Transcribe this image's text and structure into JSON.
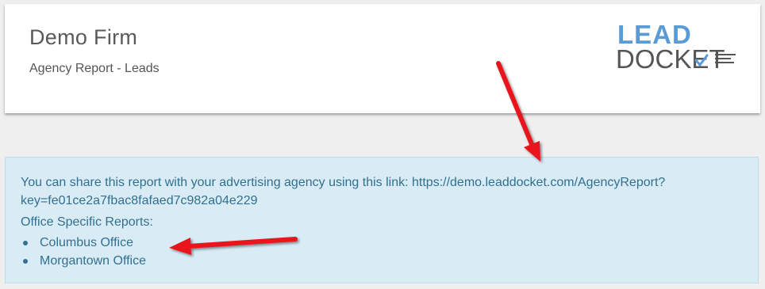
{
  "header": {
    "firm_name": "Demo Firm",
    "report_title": "Agency Report - Leads",
    "logo": {
      "top_text": "LEAD",
      "bottom_text": "DOCKET",
      "accent_color": "#5b9bd5",
      "text_color": "#555555"
    }
  },
  "share": {
    "message": "You can share this report with your advertising agency using this link: https://demo.leaddocket.com/AgencyReport?key=fe01ce2a7fbac8fafaed7c982a04e229"
  },
  "offices": {
    "label": "Office Specific Reports:",
    "items": [
      {
        "label": "Columbus Office"
      },
      {
        "label": "Morgantown Office"
      }
    ]
  },
  "annotations": {
    "arrow_color": "#e8131b"
  }
}
